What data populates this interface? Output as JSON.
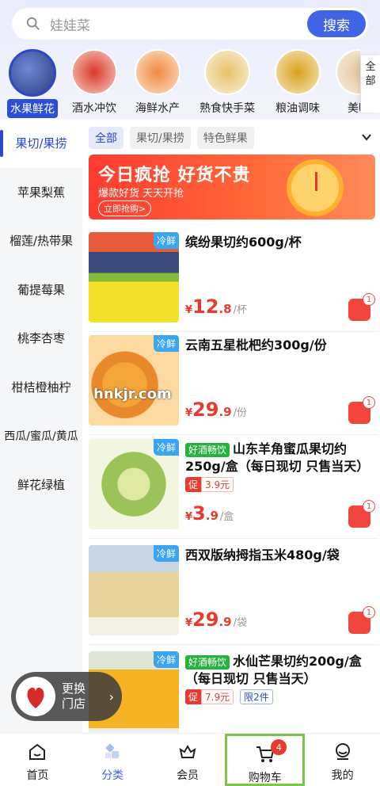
{
  "search": {
    "placeholder": "娃娃菜",
    "button": "搜索"
  },
  "categories": [
    {
      "label": "水果鲜花"
    },
    {
      "label": "酒水冲饮"
    },
    {
      "label": "海鲜水产"
    },
    {
      "label": "熟食快手菜"
    },
    {
      "label": "粮油调味"
    },
    {
      "label": "美味"
    }
  ],
  "all_categories": "全部",
  "sidebar": {
    "items": [
      {
        "label": "果切/果捞"
      },
      {
        "label": "苹果梨蕉"
      },
      {
        "label": "榴莲/热带果"
      },
      {
        "label": "葡提莓果"
      },
      {
        "label": "桃李杏枣"
      },
      {
        "label": "柑桔橙柚柠"
      },
      {
        "label": "西瓜/蜜瓜/黄瓜"
      },
      {
        "label": "鲜花绿植"
      }
    ]
  },
  "filter_tabs": [
    {
      "label": "全部"
    },
    {
      "label": "果切/果捞"
    },
    {
      "label": "特色鲜果"
    }
  ],
  "banner": {
    "title": "今日疯抢 好货不贵",
    "subtitle": "爆款好货 天天开抢",
    "cta": "立即抢购>"
  },
  "products": [
    {
      "tag": "冷鲜",
      "name": "缤纷果切约600g/杯",
      "price_int": "12",
      "price_dec": ".8",
      "unit": "/杯",
      "cart_count": "1"
    },
    {
      "tag": "冷鲜",
      "name": "云南五星枇杷约300g/份",
      "price_int": "29",
      "price_dec": ".9",
      "unit": "/份",
      "cart_count": "1"
    },
    {
      "tag": "冷鲜",
      "badge": "好酒畅饮",
      "name": "山东羊角蜜瓜果切约250g/盒（每日现切 只售当天）",
      "promo": "促",
      "promo_price": "3.9元",
      "price_int": "3",
      "price_dec": ".9",
      "unit": "/盒",
      "cart_count": "1"
    },
    {
      "tag": "冷鲜",
      "name": "西双版纳拇指玉米480g/袋",
      "price_int": "29",
      "price_dec": ".9",
      "unit": "/袋",
      "cart_count": "1"
    },
    {
      "tag": "冷鲜",
      "badge": "好酒畅饮",
      "name": "水仙芒果切约200g/盒（每日现切 只售当天）",
      "promo": "促",
      "promo_price": "7.9元",
      "limit": "限2件"
    }
  ],
  "watermark": "hnkjr.com",
  "store": {
    "line1": "更换",
    "line2": "门店"
  },
  "nav": [
    {
      "label": "首页"
    },
    {
      "label": "分类"
    },
    {
      "label": "会员"
    },
    {
      "label": "购物车"
    },
    {
      "label": "我的"
    }
  ],
  "cart_badge": "4",
  "colors": {
    "accent": "#3f64e6",
    "price": "#e83a2e",
    "fresh": "#3aa5f0",
    "hot": "#27b13f"
  }
}
